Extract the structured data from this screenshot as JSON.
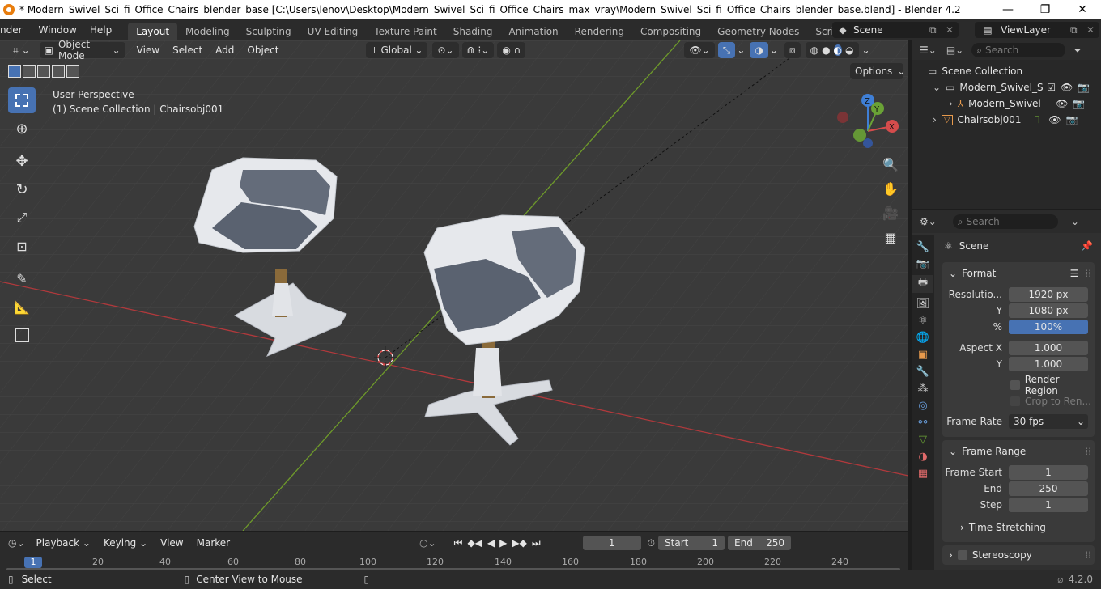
{
  "window": {
    "title": "* Modern_Swivel_Sci_fi_Office_Chairs_blender_base [C:\\Users\\lenov\\Desktop\\Modern_Swivel_Sci_fi_Office_Chairs_max_vray\\Modern_Swivel_Sci_fi_Office_Chairs_blender_base.blend] - Blender 4.2",
    "minimize": "—",
    "maximize": "❐",
    "close": "✕"
  },
  "menubar": {
    "menus": [
      "nder",
      "Window",
      "Help"
    ],
    "workspaces": [
      "Layout",
      "Modeling",
      "Sculpting",
      "UV Editing",
      "Texture Paint",
      "Shading",
      "Animation",
      "Rendering",
      "Compositing",
      "Geometry Nodes",
      "Scripting"
    ],
    "add_tab": "+",
    "scene": "Scene",
    "view_layer": "ViewLayer"
  },
  "viewport_header": {
    "mode": "Object Mode",
    "menus": [
      "View",
      "Select",
      "Add",
      "Object"
    ],
    "orientation": "Global",
    "options": "Options"
  },
  "viewport": {
    "perspective": "User Perspective",
    "collection_info": "(1) Scene Collection | Chairsobj001",
    "gizmo": {
      "z": "Z",
      "y": "Y",
      "x": "X"
    }
  },
  "outliner": {
    "search_placeholder": "Search",
    "items": [
      {
        "label": "Scene Collection"
      },
      {
        "label": "Modern_Swivel_Sci"
      },
      {
        "label": "Modern_Swivel"
      },
      {
        "label": "Chairsobj001"
      }
    ]
  },
  "properties": {
    "search_placeholder": "Search",
    "context": "Scene",
    "format_panel": {
      "title": "Format",
      "resolution_label": "Resolutio...",
      "res_x": "1920 px",
      "y_label": "Y",
      "res_y": "1080 px",
      "pct_label": "%",
      "pct": "100%",
      "aspect_label": "Aspect X",
      "aspect_x": "1.000",
      "aspect_y_label": "Y",
      "aspect_y": "1.000",
      "render_region": "Render Region",
      "crop": "Crop to Ren...",
      "frame_rate_label": "Frame Rate",
      "frame_rate": "30 fps"
    },
    "frame_range_panel": {
      "title": "Frame Range",
      "start_label": "Frame Start",
      "start": "1",
      "end_label": "End",
      "end": "250",
      "step_label": "Step",
      "step": "1"
    },
    "time_stretching": "Time Stretching",
    "stereoscopy": "Stereoscopy"
  },
  "timeline": {
    "menus": [
      "Playback",
      "Keying",
      "View",
      "Marker"
    ],
    "current_frame": "1",
    "start_label": "Start",
    "start": "1",
    "end_label": "End",
    "end": "250",
    "ruler": [
      "1",
      "20",
      "40",
      "60",
      "80",
      "100",
      "120",
      "140",
      "160",
      "180",
      "200",
      "220",
      "240"
    ]
  },
  "statusbar": {
    "select": "Select",
    "center": "Center View to Mouse",
    "version": "4.2.0"
  },
  "colors": {
    "accent": "#4772b3",
    "x_axis": "#c0393b",
    "y_axis": "#7a9a2b",
    "header": "#2b2b2b",
    "viewport": "#3a3a3a"
  }
}
